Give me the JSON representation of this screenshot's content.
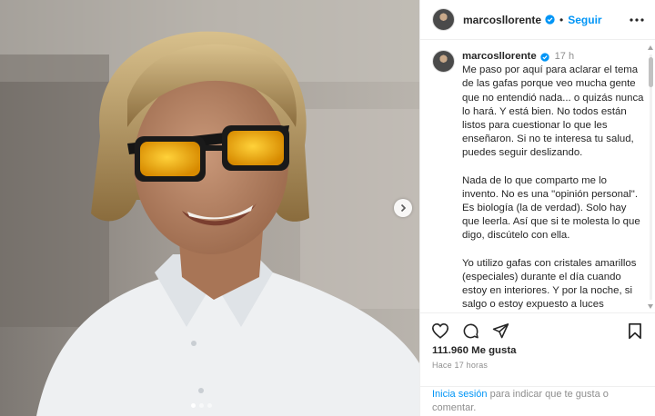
{
  "post": {
    "username": "marcosllorente",
    "follow_label": "Seguir",
    "separator": "•",
    "timestamp_short": "17 h",
    "caption_paragraphs": [
      "Me paso por aquí para aclarar el tema de las gafas porque veo mucha gente que no entendió nada... o quizás nunca lo hará. Y está bien. No todos están listos para cuestionar lo que les enseñaron. Si no te interesa tu salud, puedes seguir deslizando.",
      "Nada de lo que comparto me lo invento. No es una \"opinión personal\". Es biología (la de verdad). Solo hay que leerla. Así que si te molesta lo que digo, discútelo con ella.",
      "Yo utilizo gafas con cristales amarillos (especiales) durante el día cuando estoy en interiores. Y por la noche, si salgo o estoy expuesto a luces artificiales, uso gafas con cristales rojos. ¿Por qué? Porque protejo mi biología. Porque la"
    ],
    "likes": "111.960 Me gusta",
    "time_ago": "Hace 17 horas",
    "login_link": "Inicia sesión",
    "login_text": " para indicar que te gusta o comentar."
  },
  "carousel": {
    "dots": 3,
    "active_dot": 1
  },
  "icons": {
    "verified": "verified-badge-icon",
    "more": "more-options-icon",
    "like": "heart-icon",
    "comment": "comment-icon",
    "share": "share-icon",
    "save": "bookmark-icon",
    "next": "chevron-right-icon"
  },
  "colors": {
    "accent": "#0095f6",
    "text": "#262626",
    "muted": "#8e8e8e",
    "border": "#efefef",
    "lens": "#f2a900"
  }
}
